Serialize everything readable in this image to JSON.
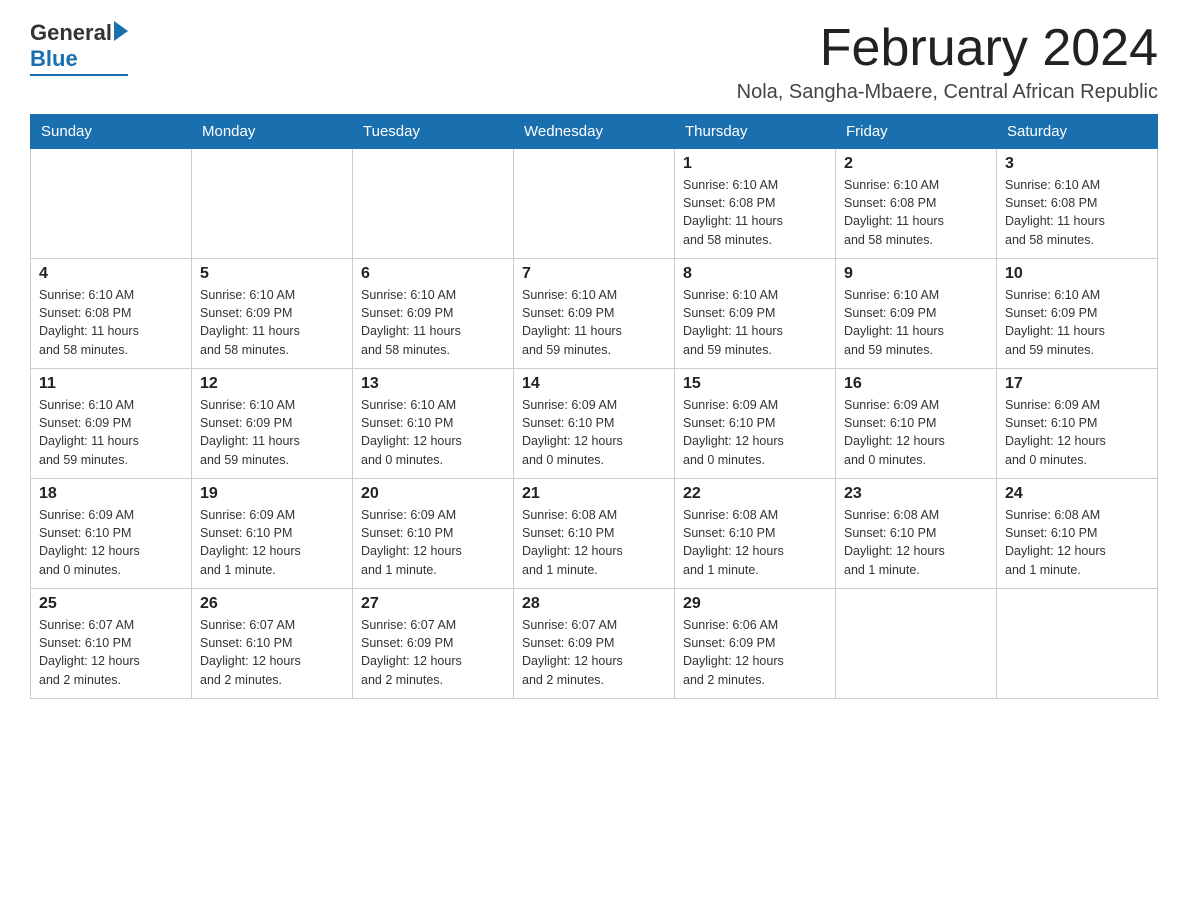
{
  "header": {
    "title": "February 2024",
    "subtitle": "Nola, Sangha-Mbaere, Central African Republic",
    "logo_general": "General",
    "logo_blue": "Blue"
  },
  "days_of_week": [
    "Sunday",
    "Monday",
    "Tuesday",
    "Wednesday",
    "Thursday",
    "Friday",
    "Saturday"
  ],
  "weeks": [
    [
      {
        "day": "",
        "info": ""
      },
      {
        "day": "",
        "info": ""
      },
      {
        "day": "",
        "info": ""
      },
      {
        "day": "",
        "info": ""
      },
      {
        "day": "1",
        "info": "Sunrise: 6:10 AM\nSunset: 6:08 PM\nDaylight: 11 hours\nand 58 minutes."
      },
      {
        "day": "2",
        "info": "Sunrise: 6:10 AM\nSunset: 6:08 PM\nDaylight: 11 hours\nand 58 minutes."
      },
      {
        "day": "3",
        "info": "Sunrise: 6:10 AM\nSunset: 6:08 PM\nDaylight: 11 hours\nand 58 minutes."
      }
    ],
    [
      {
        "day": "4",
        "info": "Sunrise: 6:10 AM\nSunset: 6:08 PM\nDaylight: 11 hours\nand 58 minutes."
      },
      {
        "day": "5",
        "info": "Sunrise: 6:10 AM\nSunset: 6:09 PM\nDaylight: 11 hours\nand 58 minutes."
      },
      {
        "day": "6",
        "info": "Sunrise: 6:10 AM\nSunset: 6:09 PM\nDaylight: 11 hours\nand 58 minutes."
      },
      {
        "day": "7",
        "info": "Sunrise: 6:10 AM\nSunset: 6:09 PM\nDaylight: 11 hours\nand 59 minutes."
      },
      {
        "day": "8",
        "info": "Sunrise: 6:10 AM\nSunset: 6:09 PM\nDaylight: 11 hours\nand 59 minutes."
      },
      {
        "day": "9",
        "info": "Sunrise: 6:10 AM\nSunset: 6:09 PM\nDaylight: 11 hours\nand 59 minutes."
      },
      {
        "day": "10",
        "info": "Sunrise: 6:10 AM\nSunset: 6:09 PM\nDaylight: 11 hours\nand 59 minutes."
      }
    ],
    [
      {
        "day": "11",
        "info": "Sunrise: 6:10 AM\nSunset: 6:09 PM\nDaylight: 11 hours\nand 59 minutes."
      },
      {
        "day": "12",
        "info": "Sunrise: 6:10 AM\nSunset: 6:09 PM\nDaylight: 11 hours\nand 59 minutes."
      },
      {
        "day": "13",
        "info": "Sunrise: 6:10 AM\nSunset: 6:10 PM\nDaylight: 12 hours\nand 0 minutes."
      },
      {
        "day": "14",
        "info": "Sunrise: 6:09 AM\nSunset: 6:10 PM\nDaylight: 12 hours\nand 0 minutes."
      },
      {
        "day": "15",
        "info": "Sunrise: 6:09 AM\nSunset: 6:10 PM\nDaylight: 12 hours\nand 0 minutes."
      },
      {
        "day": "16",
        "info": "Sunrise: 6:09 AM\nSunset: 6:10 PM\nDaylight: 12 hours\nand 0 minutes."
      },
      {
        "day": "17",
        "info": "Sunrise: 6:09 AM\nSunset: 6:10 PM\nDaylight: 12 hours\nand 0 minutes."
      }
    ],
    [
      {
        "day": "18",
        "info": "Sunrise: 6:09 AM\nSunset: 6:10 PM\nDaylight: 12 hours\nand 0 minutes."
      },
      {
        "day": "19",
        "info": "Sunrise: 6:09 AM\nSunset: 6:10 PM\nDaylight: 12 hours\nand 1 minute."
      },
      {
        "day": "20",
        "info": "Sunrise: 6:09 AM\nSunset: 6:10 PM\nDaylight: 12 hours\nand 1 minute."
      },
      {
        "day": "21",
        "info": "Sunrise: 6:08 AM\nSunset: 6:10 PM\nDaylight: 12 hours\nand 1 minute."
      },
      {
        "day": "22",
        "info": "Sunrise: 6:08 AM\nSunset: 6:10 PM\nDaylight: 12 hours\nand 1 minute."
      },
      {
        "day": "23",
        "info": "Sunrise: 6:08 AM\nSunset: 6:10 PM\nDaylight: 12 hours\nand 1 minute."
      },
      {
        "day": "24",
        "info": "Sunrise: 6:08 AM\nSunset: 6:10 PM\nDaylight: 12 hours\nand 1 minute."
      }
    ],
    [
      {
        "day": "25",
        "info": "Sunrise: 6:07 AM\nSunset: 6:10 PM\nDaylight: 12 hours\nand 2 minutes."
      },
      {
        "day": "26",
        "info": "Sunrise: 6:07 AM\nSunset: 6:10 PM\nDaylight: 12 hours\nand 2 minutes."
      },
      {
        "day": "27",
        "info": "Sunrise: 6:07 AM\nSunset: 6:09 PM\nDaylight: 12 hours\nand 2 minutes."
      },
      {
        "day": "28",
        "info": "Sunrise: 6:07 AM\nSunset: 6:09 PM\nDaylight: 12 hours\nand 2 minutes."
      },
      {
        "day": "29",
        "info": "Sunrise: 6:06 AM\nSunset: 6:09 PM\nDaylight: 12 hours\nand 2 minutes."
      },
      {
        "day": "",
        "info": ""
      },
      {
        "day": "",
        "info": ""
      }
    ]
  ]
}
